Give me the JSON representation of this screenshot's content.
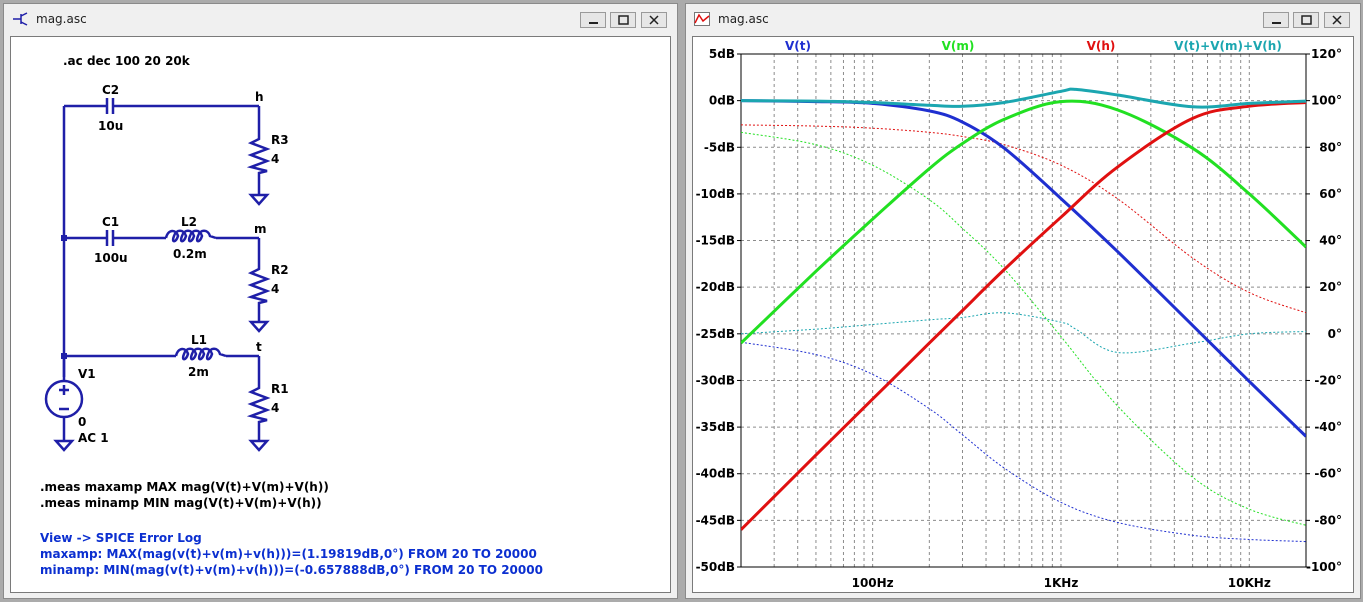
{
  "colors": {
    "wire": "#1f1fa8",
    "vt": "#1f2fd0",
    "vm": "#22e022",
    "vh": "#e01010",
    "vsum": "#1ba6b0",
    "log_text": "#0b2fd0"
  },
  "schematic_window": {
    "title": "mag.asc",
    "icon": "schematic-icon",
    "directive_ac": ".ac dec 100 20 20k",
    "components": {
      "c2": {
        "name": "C2",
        "value": "10u"
      },
      "r3": {
        "name": "R3",
        "value": "4"
      },
      "c1": {
        "name": "C1",
        "value": "100u"
      },
      "l2": {
        "name": "L2",
        "value": "0.2m"
      },
      "r2": {
        "name": "R2",
        "value": "4"
      },
      "l1": {
        "name": "L1",
        "value": "2m"
      },
      "r1": {
        "name": "R1",
        "value": "4"
      },
      "v1": {
        "name": "V1",
        "value": "0",
        "ac": "AC 1"
      }
    },
    "nets": {
      "h": "h",
      "m": "m",
      "t": "t"
    },
    "meas_max": ".meas maxamp MAX mag(V(t)+V(m)+V(h))",
    "meas_min": ".meas minamp MIN mag(V(t)+V(m)+V(h))",
    "log_header": "View -> SPICE Error Log",
    "log_max": "maxamp: MAX(mag(v(t)+v(m)+v(h)))=(1.19819dB,0°) FROM 20 TO 20000",
    "log_min": "minamp: MIN(mag(v(t)+v(m)+v(h)))=(-0.657888dB,0°) FROM 20 TO 20000"
  },
  "waveform_window": {
    "title": "mag.asc",
    "icon": "waveform-icon"
  },
  "chart_data": {
    "type": "line",
    "x_scale": "log",
    "xlim": [
      20,
      20000
    ],
    "x_ticks": [
      "100Hz",
      "1KHz",
      "10KHz"
    ],
    "x_tick_values": [
      100,
      1000,
      10000
    ],
    "ylim_left": [
      -50,
      5
    ],
    "y_left_ticks": [
      "5dB",
      "0dB",
      "-5dB",
      "-10dB",
      "-15dB",
      "-20dB",
      "-25dB",
      "-30dB",
      "-35dB",
      "-40dB",
      "-45dB",
      "-50dB"
    ],
    "y_left_tick_values": [
      5,
      0,
      -5,
      -10,
      -15,
      -20,
      -25,
      -30,
      -35,
      -40,
      -45,
      -50
    ],
    "ylim_right": [
      -100,
      120
    ],
    "y_right_ticks": [
      "120°",
      "100°",
      "80°",
      "60°",
      "40°",
      "20°",
      "0°",
      "-20°",
      "-40°",
      "-60°",
      "-80°",
      "-100°"
    ],
    "y_right_tick_values": [
      120,
      100,
      80,
      60,
      40,
      20,
      0,
      -20,
      -40,
      -60,
      -80,
      -100
    ],
    "grid": true,
    "legend_position": "top",
    "series": [
      {
        "name": "V(t)",
        "color": "#1f2fd0",
        "x": [
          20,
          50,
          100,
          200,
          300,
          500,
          1000,
          2000,
          5000,
          10000,
          20000
        ],
        "mag": [
          0,
          -0.1,
          -0.3,
          -1.1,
          -2.3,
          -5.1,
          -10.5,
          -16.2,
          -24.1,
          -30.1,
          -36
        ],
        "phase": [
          -3.6,
          -8.9,
          -17.4,
          -32.1,
          -43.3,
          -57.6,
          -72.3,
          -80.9,
          -86.4,
          -88.2,
          -89.1
        ]
      },
      {
        "name": "V(m)",
        "color": "#22e022",
        "x": [
          20,
          50,
          100,
          200,
          300,
          500,
          1000,
          2000,
          5000,
          10000,
          20000
        ],
        "mag": [
          -26,
          -18.3,
          -12.7,
          -7.3,
          -4.6,
          -2,
          -0.1,
          -1,
          -5.1,
          -10,
          -15.7
        ],
        "phase": [
          86.4,
          81.1,
          72.3,
          57.5,
          45.2,
          27.8,
          -1.2,
          -31,
          -61.5,
          -75.2,
          -82.1
        ]
      },
      {
        "name": "V(h)",
        "color": "#e01010",
        "x": [
          20,
          50,
          100,
          200,
          300,
          500,
          1000,
          2000,
          5000,
          10000,
          20000
        ],
        "mag": [
          -46,
          -38,
          -32,
          -26,
          -22.5,
          -18.1,
          -12.5,
          -7.1,
          -1.9,
          -0.6,
          -0.2
        ],
        "phase": [
          89.6,
          89.1,
          88.2,
          86.4,
          84.6,
          81.1,
          72.3,
          57.9,
          32.5,
          17.7,
          9
        ]
      },
      {
        "name": "V(t)+V(m)+V(h)",
        "color": "#1ba6b0",
        "x": [
          20,
          50,
          100,
          200,
          300,
          500,
          1000,
          1200,
          2000,
          5000,
          10000,
          20000
        ],
        "mag": [
          0,
          -0.05,
          -0.2,
          -0.5,
          -0.6,
          -0.2,
          1,
          1.2,
          0.6,
          -0.66,
          -0.3,
          -0.05
        ],
        "phase": [
          0,
          2,
          4,
          6,
          7,
          9,
          5,
          2,
          -8,
          -4,
          0,
          1
        ]
      }
    ]
  }
}
